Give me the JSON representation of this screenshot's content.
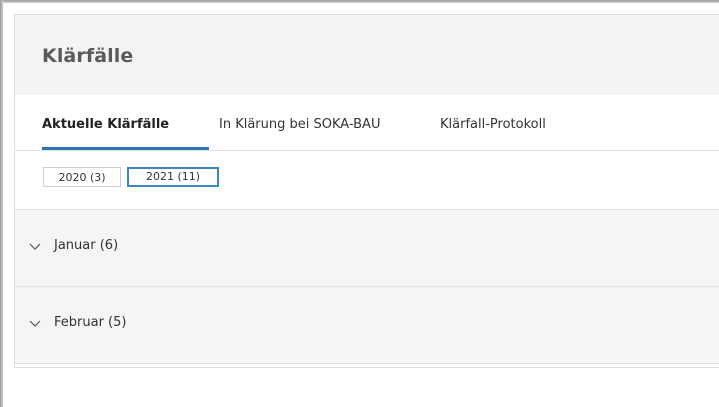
{
  "panel": {
    "title": "Klärfälle"
  },
  "tabs": [
    {
      "label": "Aktuelle Klärfälle",
      "active": true
    },
    {
      "label": "In Klärung bei SOKA-BAU",
      "active": false
    },
    {
      "label": "Klärfall-Protokoll",
      "active": false
    }
  ],
  "years": [
    {
      "label": "2020 (3)",
      "selected": false
    },
    {
      "label": "2021 (11)",
      "selected": true
    }
  ],
  "months": [
    {
      "label": "Januar (6)",
      "icon": "chevron-down-icon"
    },
    {
      "label": "Februar (5)",
      "icon": "chevron-down-icon"
    }
  ],
  "colors": {
    "accent": "#2b74b8",
    "selected_border": "#3d86c6",
    "header_bg": "#f4f4f4"
  }
}
